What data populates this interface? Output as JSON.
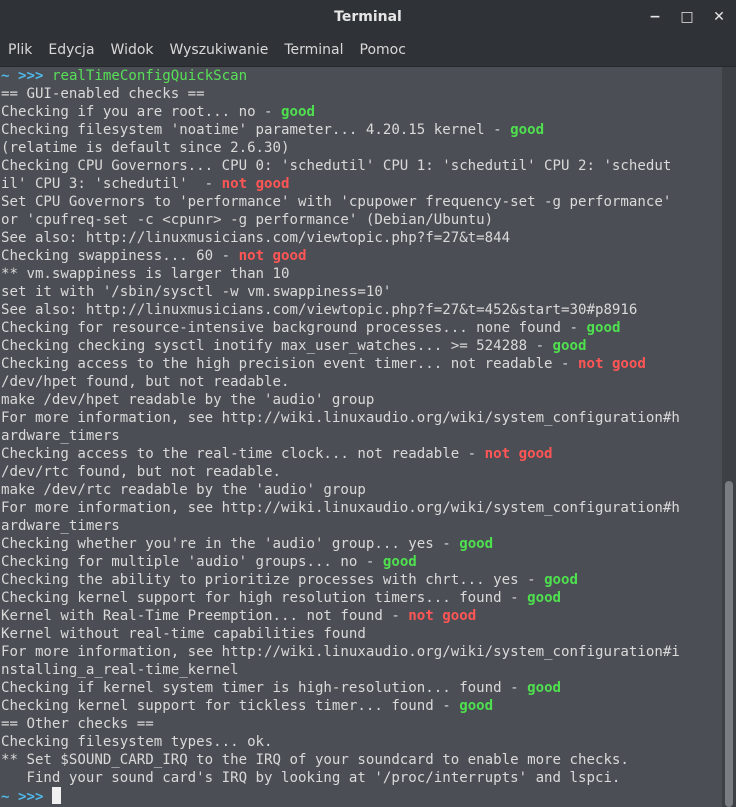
{
  "window": {
    "title": "Terminal",
    "minimize": "−",
    "maximize": "□",
    "close": "✕"
  },
  "menu": [
    "Plik",
    "Edycja",
    "Widok",
    "Wyszukiwanie",
    "Terminal",
    "Pomoc"
  ],
  "prompt": {
    "tilde": "~",
    "arrows": ">>>",
    "command": "realTimeConfigQuickScan"
  },
  "lines": [
    [
      [
        "== GUI-enabled checks ==",
        ""
      ]
    ],
    [
      [
        "Checking if you are root... no - ",
        ""
      ],
      [
        "good",
        "good"
      ]
    ],
    [
      [
        "Checking filesystem 'noatime' parameter... 4.20.15 kernel - ",
        ""
      ],
      [
        "good",
        "good"
      ]
    ],
    [
      [
        "(relatime is default since 2.6.30)",
        ""
      ]
    ],
    [
      [
        "Checking CPU Governors... CPU 0: 'schedutil' CPU 1: 'schedutil' CPU 2: 'schedut",
        ""
      ]
    ],
    [
      [
        "il' CPU 3: 'schedutil'  - ",
        ""
      ],
      [
        "not good",
        "bad"
      ]
    ],
    [
      [
        "Set CPU Governors to 'performance' with 'cpupower frequency-set -g performance'",
        ""
      ]
    ],
    [
      [
        "or 'cpufreq-set -c <cpunr> -g performance' (Debian/Ubuntu)",
        ""
      ]
    ],
    [
      [
        "See also: http://linuxmusicians.com/viewtopic.php?f=27&t=844",
        ""
      ]
    ],
    [
      [
        "Checking swappiness... 60 - ",
        ""
      ],
      [
        "not good",
        "bad"
      ]
    ],
    [
      [
        "** vm.swappiness is larger than 10",
        ""
      ]
    ],
    [
      [
        "set it with '/sbin/sysctl -w vm.swappiness=10'",
        ""
      ]
    ],
    [
      [
        "See also: http://linuxmusicians.com/viewtopic.php?f=27&t=452&start=30#p8916",
        ""
      ]
    ],
    [
      [
        "Checking for resource-intensive background processes... none found - ",
        ""
      ],
      [
        "good",
        "good"
      ]
    ],
    [
      [
        "Checking checking sysctl inotify max_user_watches... >= 524288 - ",
        ""
      ],
      [
        "good",
        "good"
      ]
    ],
    [
      [
        "Checking access to the high precision event timer... not readable - ",
        ""
      ],
      [
        "not good",
        "bad"
      ]
    ],
    [
      [
        "/dev/hpet found, but not readable.",
        ""
      ]
    ],
    [
      [
        "make /dev/hpet readable by the 'audio' group",
        ""
      ]
    ],
    [
      [
        "For more information, see http://wiki.linuxaudio.org/wiki/system_configuration#h",
        ""
      ]
    ],
    [
      [
        "ardware_timers",
        ""
      ]
    ],
    [
      [
        "Checking access to the real-time clock... not readable - ",
        ""
      ],
      [
        "not good",
        "bad"
      ]
    ],
    [
      [
        "/dev/rtc found, but not readable.",
        ""
      ]
    ],
    [
      [
        "make /dev/rtc readable by the 'audio' group",
        ""
      ]
    ],
    [
      [
        "For more information, see http://wiki.linuxaudio.org/wiki/system_configuration#h",
        ""
      ]
    ],
    [
      [
        "ardware_timers",
        ""
      ]
    ],
    [
      [
        "Checking whether you're in the 'audio' group... yes - ",
        ""
      ],
      [
        "good",
        "good"
      ]
    ],
    [
      [
        "Checking for multiple 'audio' groups... no - ",
        ""
      ],
      [
        "good",
        "good"
      ]
    ],
    [
      [
        "Checking the ability to prioritize processes with chrt... yes - ",
        ""
      ],
      [
        "good",
        "good"
      ]
    ],
    [
      [
        "Checking kernel support for high resolution timers... found - ",
        ""
      ],
      [
        "good",
        "good"
      ]
    ],
    [
      [
        "Kernel with Real-Time Preemption... not found - ",
        ""
      ],
      [
        "not good",
        "bad"
      ]
    ],
    [
      [
        "Kernel without real-time capabilities found",
        ""
      ]
    ],
    [
      [
        "For more information, see http://wiki.linuxaudio.org/wiki/system_configuration#i",
        ""
      ]
    ],
    [
      [
        "nstalling_a_real-time_kernel",
        ""
      ]
    ],
    [
      [
        "Checking if kernel system timer is high-resolution... found - ",
        ""
      ],
      [
        "good",
        "good"
      ]
    ],
    [
      [
        "Checking kernel support for tickless timer... found - ",
        ""
      ],
      [
        "good",
        "good"
      ]
    ],
    [
      [
        "== Other checks ==",
        ""
      ]
    ],
    [
      [
        "Checking filesystem types... ok.",
        ""
      ]
    ],
    [
      [
        "** Set $SOUND_CARD_IRQ to the IRQ of your soundcard to enable more checks.",
        ""
      ]
    ],
    [
      [
        "   Find your sound card's IRQ by looking at '/proc/interrupts' and lspci.",
        ""
      ]
    ]
  ],
  "scroll_position_fraction": 0.56
}
